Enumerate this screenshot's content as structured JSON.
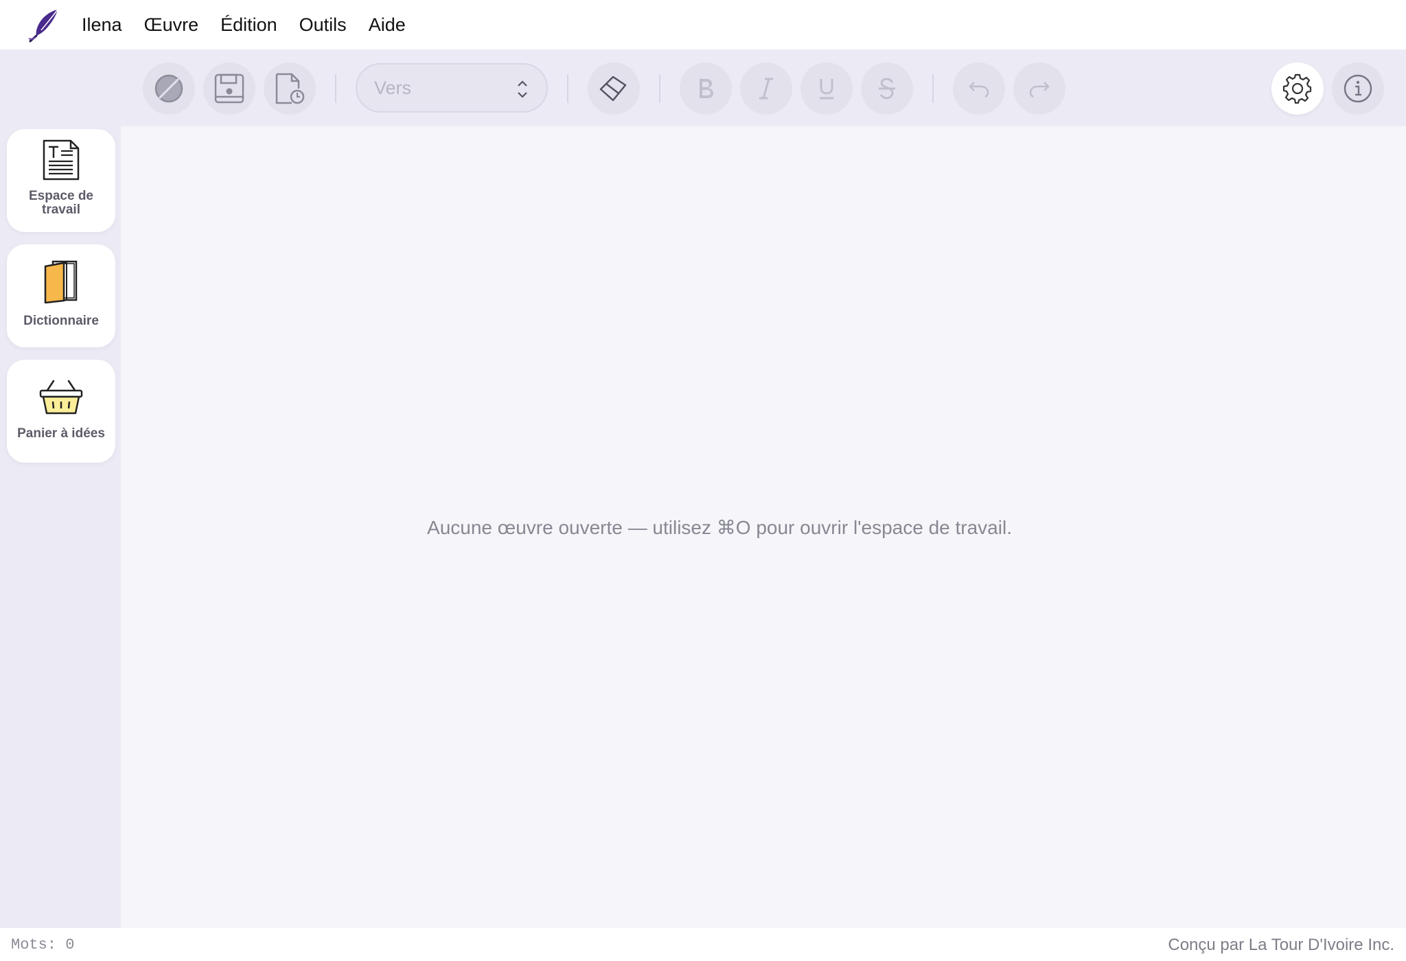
{
  "menubar": {
    "logo_icon": "feather-quill-icon",
    "items": [
      "Ilena",
      "Œuvre",
      "Édition",
      "Outils",
      "Aide"
    ]
  },
  "toolbar": {
    "buttons": [
      {
        "name": "close-work-button",
        "icon": "slash-circle-icon"
      },
      {
        "name": "save-button",
        "icon": "floppy-disk-icon"
      },
      {
        "name": "history-button",
        "icon": "document-clock-icon"
      },
      {
        "name": "eraser-button",
        "icon": "eraser-icon"
      },
      {
        "name": "bold-button",
        "icon": "bold-icon",
        "label": "B"
      },
      {
        "name": "italic-button",
        "icon": "italic-icon",
        "label": "I"
      },
      {
        "name": "underline-button",
        "icon": "underline-icon",
        "label": "U"
      },
      {
        "name": "strikethrough-button",
        "icon": "strikethrough-icon",
        "label": "S"
      },
      {
        "name": "undo-button",
        "icon": "undo-icon"
      },
      {
        "name": "redo-button",
        "icon": "redo-icon"
      },
      {
        "name": "settings-button",
        "icon": "gear-icon"
      },
      {
        "name": "info-button",
        "icon": "info-icon"
      }
    ],
    "style_select": {
      "value": "Vers"
    }
  },
  "sidebar": {
    "items": [
      {
        "label": "Espace de travail",
        "icon": "document-text-icon"
      },
      {
        "label": "Dictionnaire",
        "icon": "book-icon"
      },
      {
        "label": "Panier à idées",
        "icon": "basket-icon"
      }
    ]
  },
  "main": {
    "empty_message": "Aucune œuvre ouverte — utilisez ⌘O pour ouvrir l'espace de travail."
  },
  "status": {
    "word_count": "Mots: 0",
    "credits": "Conçu par La Tour D'Ivoire Inc."
  },
  "colors": {
    "background": "#ecebf5",
    "editor": "#f6f6fa",
    "disabled_button": "#e2e1ec",
    "icon_disabled": "#b9b8c6",
    "icon_active": "#333333",
    "book_orange": "#f7b84b",
    "basket_yellow": "#fbee98",
    "quill_purple": "#4a2a8c"
  }
}
